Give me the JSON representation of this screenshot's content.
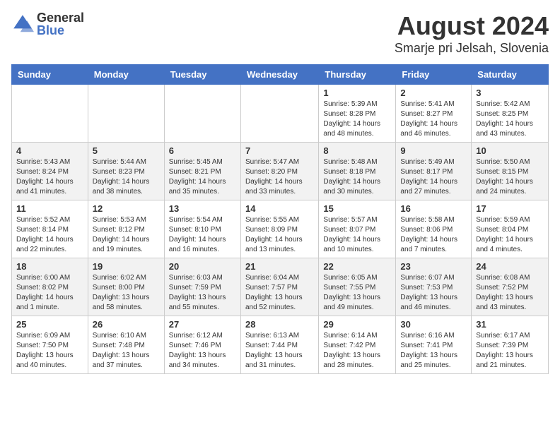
{
  "logo": {
    "general": "General",
    "blue": "Blue"
  },
  "title": {
    "month": "August 2024",
    "location": "Smarje pri Jelsah, Slovenia"
  },
  "headers": [
    "Sunday",
    "Monday",
    "Tuesday",
    "Wednesday",
    "Thursday",
    "Friday",
    "Saturday"
  ],
  "weeks": [
    [
      {
        "day": "",
        "content": ""
      },
      {
        "day": "",
        "content": ""
      },
      {
        "day": "",
        "content": ""
      },
      {
        "day": "",
        "content": ""
      },
      {
        "day": "1",
        "content": "Sunrise: 5:39 AM\nSunset: 8:28 PM\nDaylight: 14 hours and 48 minutes."
      },
      {
        "day": "2",
        "content": "Sunrise: 5:41 AM\nSunset: 8:27 PM\nDaylight: 14 hours and 46 minutes."
      },
      {
        "day": "3",
        "content": "Sunrise: 5:42 AM\nSunset: 8:25 PM\nDaylight: 14 hours and 43 minutes."
      }
    ],
    [
      {
        "day": "4",
        "content": "Sunrise: 5:43 AM\nSunset: 8:24 PM\nDaylight: 14 hours and 41 minutes."
      },
      {
        "day": "5",
        "content": "Sunrise: 5:44 AM\nSunset: 8:23 PM\nDaylight: 14 hours and 38 minutes."
      },
      {
        "day": "6",
        "content": "Sunrise: 5:45 AM\nSunset: 8:21 PM\nDaylight: 14 hours and 35 minutes."
      },
      {
        "day": "7",
        "content": "Sunrise: 5:47 AM\nSunset: 8:20 PM\nDaylight: 14 hours and 33 minutes."
      },
      {
        "day": "8",
        "content": "Sunrise: 5:48 AM\nSunset: 8:18 PM\nDaylight: 14 hours and 30 minutes."
      },
      {
        "day": "9",
        "content": "Sunrise: 5:49 AM\nSunset: 8:17 PM\nDaylight: 14 hours and 27 minutes."
      },
      {
        "day": "10",
        "content": "Sunrise: 5:50 AM\nSunset: 8:15 PM\nDaylight: 14 hours and 24 minutes."
      }
    ],
    [
      {
        "day": "11",
        "content": "Sunrise: 5:52 AM\nSunset: 8:14 PM\nDaylight: 14 hours and 22 minutes."
      },
      {
        "day": "12",
        "content": "Sunrise: 5:53 AM\nSunset: 8:12 PM\nDaylight: 14 hours and 19 minutes."
      },
      {
        "day": "13",
        "content": "Sunrise: 5:54 AM\nSunset: 8:10 PM\nDaylight: 14 hours and 16 minutes."
      },
      {
        "day": "14",
        "content": "Sunrise: 5:55 AM\nSunset: 8:09 PM\nDaylight: 14 hours and 13 minutes."
      },
      {
        "day": "15",
        "content": "Sunrise: 5:57 AM\nSunset: 8:07 PM\nDaylight: 14 hours and 10 minutes."
      },
      {
        "day": "16",
        "content": "Sunrise: 5:58 AM\nSunset: 8:06 PM\nDaylight: 14 hours and 7 minutes."
      },
      {
        "day": "17",
        "content": "Sunrise: 5:59 AM\nSunset: 8:04 PM\nDaylight: 14 hours and 4 minutes."
      }
    ],
    [
      {
        "day": "18",
        "content": "Sunrise: 6:00 AM\nSunset: 8:02 PM\nDaylight: 14 hours and 1 minute."
      },
      {
        "day": "19",
        "content": "Sunrise: 6:02 AM\nSunset: 8:00 PM\nDaylight: 13 hours and 58 minutes."
      },
      {
        "day": "20",
        "content": "Sunrise: 6:03 AM\nSunset: 7:59 PM\nDaylight: 13 hours and 55 minutes."
      },
      {
        "day": "21",
        "content": "Sunrise: 6:04 AM\nSunset: 7:57 PM\nDaylight: 13 hours and 52 minutes."
      },
      {
        "day": "22",
        "content": "Sunrise: 6:05 AM\nSunset: 7:55 PM\nDaylight: 13 hours and 49 minutes."
      },
      {
        "day": "23",
        "content": "Sunrise: 6:07 AM\nSunset: 7:53 PM\nDaylight: 13 hours and 46 minutes."
      },
      {
        "day": "24",
        "content": "Sunrise: 6:08 AM\nSunset: 7:52 PM\nDaylight: 13 hours and 43 minutes."
      }
    ],
    [
      {
        "day": "25",
        "content": "Sunrise: 6:09 AM\nSunset: 7:50 PM\nDaylight: 13 hours and 40 minutes."
      },
      {
        "day": "26",
        "content": "Sunrise: 6:10 AM\nSunset: 7:48 PM\nDaylight: 13 hours and 37 minutes."
      },
      {
        "day": "27",
        "content": "Sunrise: 6:12 AM\nSunset: 7:46 PM\nDaylight: 13 hours and 34 minutes."
      },
      {
        "day": "28",
        "content": "Sunrise: 6:13 AM\nSunset: 7:44 PM\nDaylight: 13 hours and 31 minutes."
      },
      {
        "day": "29",
        "content": "Sunrise: 6:14 AM\nSunset: 7:42 PM\nDaylight: 13 hours and 28 minutes."
      },
      {
        "day": "30",
        "content": "Sunrise: 6:16 AM\nSunset: 7:41 PM\nDaylight: 13 hours and 25 minutes."
      },
      {
        "day": "31",
        "content": "Sunrise: 6:17 AM\nSunset: 7:39 PM\nDaylight: 13 hours and 21 minutes."
      }
    ]
  ]
}
